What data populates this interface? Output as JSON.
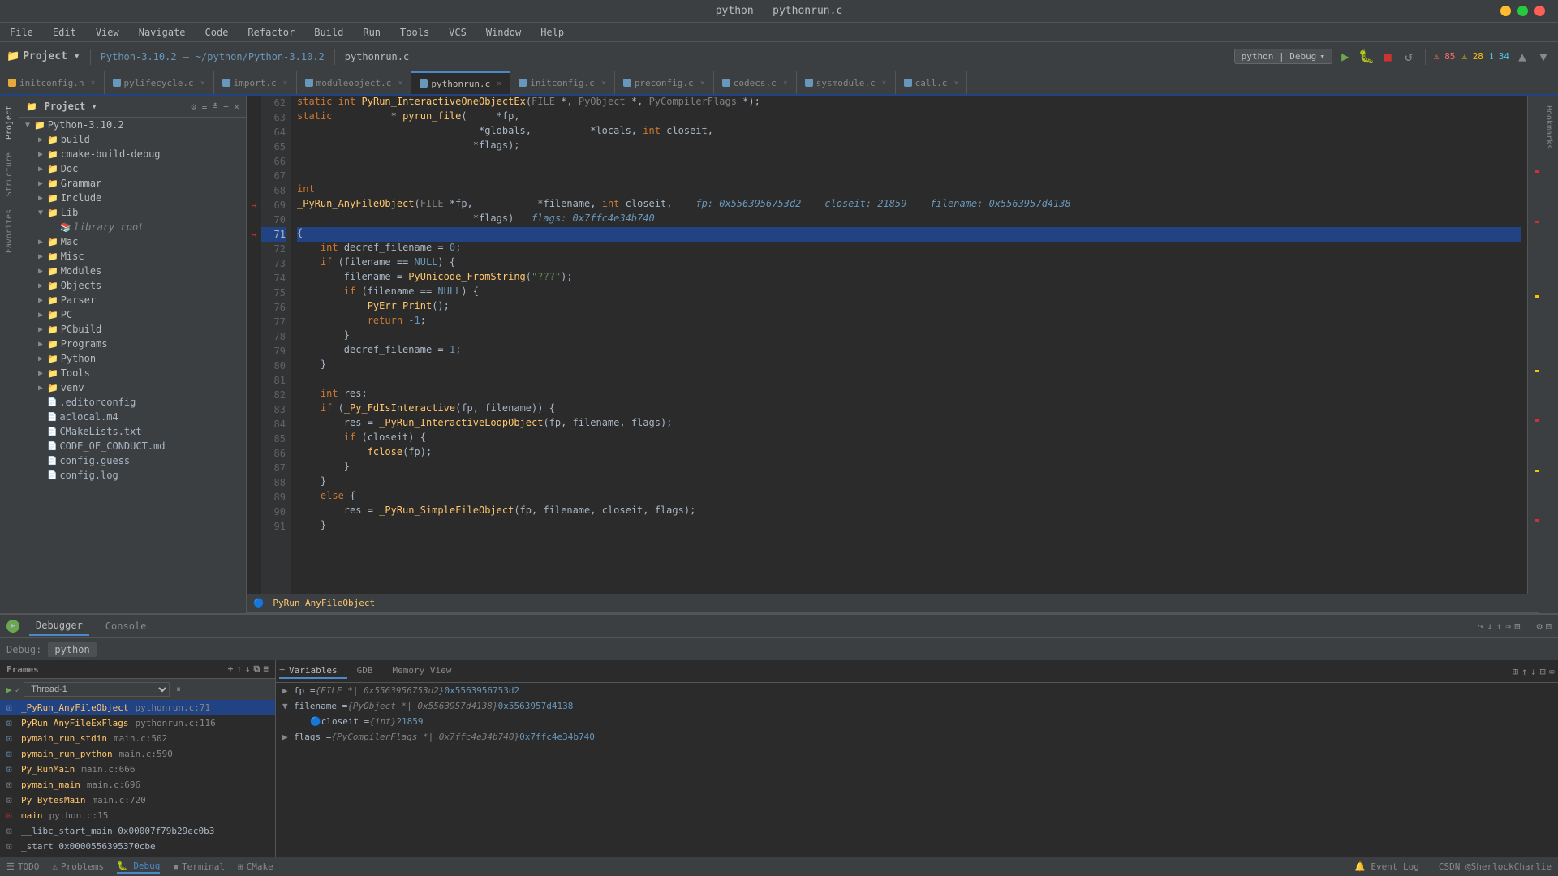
{
  "window": {
    "title": "python – pythonrun.c"
  },
  "traffic_lights": {
    "close": "×",
    "minimize": "−",
    "maximize": "+"
  },
  "menu": {
    "items": [
      "File",
      "Edit",
      "View",
      "Navigate",
      "Code",
      "Refactor",
      "Build",
      "Run",
      "Tools",
      "VCS",
      "Window",
      "Help"
    ]
  },
  "toolbar": {
    "project_label": "Project ▾",
    "branch": "Python-3.10.2",
    "path": "~/python/Python-3.10.2",
    "active_file": "pythonrun.c",
    "debug_config": "python | Debug",
    "errors": "85",
    "warnings": "28",
    "info": "34"
  },
  "tabs": [
    {
      "label": "initconfig.h",
      "active": false
    },
    {
      "label": "pylifecycle.c",
      "active": false
    },
    {
      "label": "import.c",
      "active": false
    },
    {
      "label": "moduleobject.c",
      "active": false
    },
    {
      "label": "pythonrun.c",
      "active": true
    },
    {
      "label": "initconfig.c",
      "active": false
    },
    {
      "label": "preconfig.c",
      "active": false
    },
    {
      "label": "codecs.c",
      "active": false
    },
    {
      "label": "sysmodule.c",
      "active": false
    },
    {
      "label": "call.c",
      "active": false
    }
  ],
  "sidebar": {
    "header": "Project ▾",
    "root": "Python-3.10.2",
    "root_path": "~/python/Python-3.10.2",
    "items": [
      {
        "label": "build",
        "type": "dir",
        "level": 2,
        "expanded": false
      },
      {
        "label": "cmake-build-debug",
        "type": "dir",
        "level": 2,
        "expanded": false
      },
      {
        "label": "Doc",
        "type": "dir",
        "level": 2,
        "expanded": false
      },
      {
        "label": "Grammar",
        "type": "dir",
        "level": 2,
        "expanded": false
      },
      {
        "label": "Include",
        "type": "dir",
        "level": 2,
        "expanded": false
      },
      {
        "label": "Lib",
        "type": "dir",
        "level": 2,
        "expanded": true
      },
      {
        "label": "library root",
        "type": "lib",
        "level": 3,
        "expanded": false
      },
      {
        "label": "Mac",
        "type": "dir",
        "level": 2,
        "expanded": false
      },
      {
        "label": "Misc",
        "type": "dir",
        "level": 2,
        "expanded": false
      },
      {
        "label": "Modules",
        "type": "dir",
        "level": 2,
        "expanded": false
      },
      {
        "label": "Objects",
        "type": "dir",
        "level": 2,
        "expanded": false
      },
      {
        "label": "Parser",
        "type": "dir",
        "level": 2,
        "expanded": false
      },
      {
        "label": "PC",
        "type": "dir",
        "level": 2,
        "expanded": false
      },
      {
        "label": "PCbuild",
        "type": "dir",
        "level": 2,
        "expanded": false
      },
      {
        "label": "Programs",
        "type": "dir",
        "level": 2,
        "expanded": false
      },
      {
        "label": "Python",
        "type": "dir",
        "level": 2,
        "expanded": false
      },
      {
        "label": "Tools",
        "type": "dir",
        "level": 2,
        "expanded": false
      },
      {
        "label": "venv",
        "type": "dir",
        "level": 2,
        "expanded": false
      },
      {
        "label": ".editorconfig",
        "type": "file",
        "level": 2
      },
      {
        "label": "aclocal.m4",
        "type": "file",
        "level": 2
      },
      {
        "label": "CMakeLists.txt",
        "type": "file",
        "level": 2
      },
      {
        "label": "CODE_OF_CONDUCT.md",
        "type": "file",
        "level": 2
      },
      {
        "label": "config.guess",
        "type": "file",
        "level": 2
      },
      {
        "label": "config.log",
        "type": "file",
        "level": 2
      }
    ]
  },
  "code": {
    "filename": "_PyRun_AnyFileObject",
    "lines": [
      {
        "num": 62,
        "content": "static int PyRun_InteractiveOneObjectEx(FILE *, PyObject *, PyCompilerFlags *);",
        "type": "normal"
      },
      {
        "num": 63,
        "content": "static          * pyrun_file(    *fp,",
        "type": "normal"
      },
      {
        "num": 64,
        "content": "                               *globals,          *locals, int closeit,",
        "type": "normal"
      },
      {
        "num": 65,
        "content": "                              *flags);",
        "type": "normal"
      },
      {
        "num": 66,
        "content": "",
        "type": "normal"
      },
      {
        "num": 67,
        "content": "",
        "type": "normal"
      },
      {
        "num": 68,
        "content": "int",
        "type": "normal"
      },
      {
        "num": 69,
        "content": "_PyRun_AnyFileObject(FILE *fp,          *filename, int closeit,    fp: 0x5563956753d2    closeit: 21859    filename: 0x5563957d4138",
        "type": "debug"
      },
      {
        "num": 70,
        "content": "                              *flags)   flags: 0x7ffc4e34b740",
        "type": "debug"
      },
      {
        "num": 71,
        "content": "{",
        "type": "current"
      },
      {
        "num": 72,
        "content": "    int decref_filename = 0;",
        "type": "normal"
      },
      {
        "num": 73,
        "content": "    if (filename == NULL) {",
        "type": "normal"
      },
      {
        "num": 74,
        "content": "        filename = PyUnicode_FromString(\"???\");",
        "type": "normal"
      },
      {
        "num": 75,
        "content": "        if (filename == NULL) {",
        "type": "normal"
      },
      {
        "num": 76,
        "content": "            PyErr_Print();",
        "type": "normal"
      },
      {
        "num": 77,
        "content": "            return -1;",
        "type": "normal"
      },
      {
        "num": 78,
        "content": "        }",
        "type": "normal"
      },
      {
        "num": 79,
        "content": "        decref_filename = 1;",
        "type": "normal"
      },
      {
        "num": 80,
        "content": "    }",
        "type": "normal"
      },
      {
        "num": 81,
        "content": "",
        "type": "normal"
      },
      {
        "num": 82,
        "content": "    int res;",
        "type": "normal"
      },
      {
        "num": 83,
        "content": "    if (_Py_FdIsInteractive(fp, filename)) {",
        "type": "normal"
      },
      {
        "num": 84,
        "content": "        res = _PyRun_InteractiveLoopObject(fp, filename, flags);",
        "type": "normal"
      },
      {
        "num": 85,
        "content": "        if (closeit) {",
        "type": "normal"
      },
      {
        "num": 86,
        "content": "            fclose(fp);",
        "type": "normal"
      },
      {
        "num": 87,
        "content": "        }",
        "type": "normal"
      },
      {
        "num": 88,
        "content": "    }",
        "type": "normal"
      },
      {
        "num": 89,
        "content": "    else {",
        "type": "normal"
      },
      {
        "num": 90,
        "content": "        res = _PyRun_SimpleFileObject(fp, filename, closeit, flags);",
        "type": "normal"
      },
      {
        "num": 91,
        "content": "    }",
        "type": "normal"
      }
    ]
  },
  "debugger": {
    "session_name": "python",
    "tabs": [
      "Debugger",
      "Console"
    ],
    "frames_header": "Frames",
    "thread": "Thread-1",
    "frames": [
      {
        "fn": "_PyRun_AnyFileObject",
        "file": "pythonrun.c:71",
        "active": true
      },
      {
        "fn": "PyRun_AnyFileExFlags",
        "file": "pythonrun.c:116",
        "active": false
      },
      {
        "fn": "pymain_run_stdin",
        "file": "main.c:502",
        "active": false
      },
      {
        "fn": "pymain_run_python",
        "file": "main.c:590",
        "active": false
      },
      {
        "fn": "Py_RunMain",
        "file": "main.c:666",
        "active": false
      },
      {
        "fn": "pymain_main",
        "file": "main.c:696",
        "active": false
      },
      {
        "fn": "Py_BytesMain",
        "file": "main.c:720",
        "active": false
      },
      {
        "fn": "main",
        "file": "python.c:15",
        "active": false
      },
      {
        "fn": "__libc_start_main",
        "file": "0x00007f79b29ec0b3",
        "active": false
      },
      {
        "fn": "_start",
        "file": "0x0000556395370cbe",
        "active": false
      }
    ],
    "vars_tabs": [
      "Variables",
      "GDB",
      "Memory View"
    ],
    "variables": [
      {
        "name": "fp",
        "type": "{FILE *}",
        "addr": "0x5563956753d2",
        "val": "0x5563956753d2",
        "expanded": false,
        "indent": 0
      },
      {
        "name": "filename",
        "type": "{PyObject *}",
        "addr": "0x5563957d4138",
        "val": "0x5563957d4138",
        "expanded": true,
        "indent": 0
      },
      {
        "name": "closeit",
        "type": "{int}",
        "addr": "",
        "val": "21859",
        "expanded": false,
        "indent": 1
      },
      {
        "name": "flags",
        "type": "{PyCompilerFlags *}",
        "addr": "0x7ffc4e34b740",
        "val": "0x7ffc4e34b740",
        "expanded": false,
        "indent": 0
      }
    ]
  },
  "status_bar": {
    "todo": "TODO",
    "problems": "Problems",
    "debug": "Debug",
    "terminal": "Terminal",
    "cmake": "CMake",
    "brand": "CSDN @SherlockCharlie"
  }
}
